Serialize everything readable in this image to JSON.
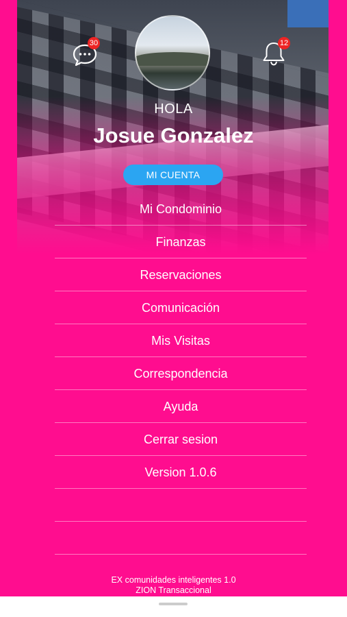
{
  "header": {
    "messages_badge": "30",
    "notifications_badge": "12",
    "greeting": "HOLA",
    "user_name": "Josue Gonzalez",
    "account_button": "MI CUENTA"
  },
  "menu": {
    "items": [
      {
        "label": "Mi Condominio"
      },
      {
        "label": "Finanzas"
      },
      {
        "label": "Reservaciones"
      },
      {
        "label": "Comunicación"
      },
      {
        "label": "Mis Visitas"
      },
      {
        "label": "Correspondencia"
      },
      {
        "label": "Ayuda"
      },
      {
        "label": "Cerrar sesion"
      },
      {
        "label": "Version 1.0.6"
      }
    ]
  },
  "footer": {
    "line1": "EX comunidades inteligentes 1.0",
    "line2": "ZION Transaccional"
  },
  "colors": {
    "background": "#ff0d8f",
    "accent_button": "#2ba5f2",
    "badge": "#ee2424"
  },
  "icons": [
    "chat-bubble-icon",
    "bell-icon"
  ]
}
